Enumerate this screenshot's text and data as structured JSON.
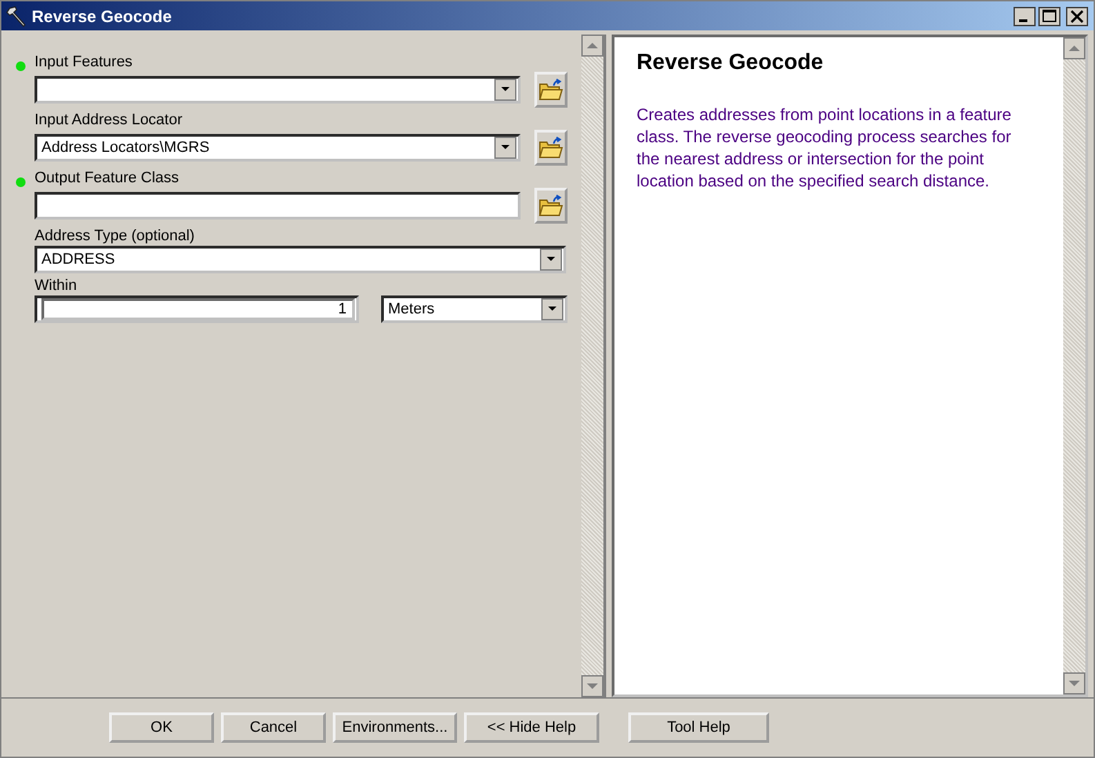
{
  "window": {
    "title": "Reverse Geocode"
  },
  "parameters": [
    {
      "kind": "combo",
      "label": "Input Features",
      "required": true
    },
    {
      "kind": "combo",
      "label": "Input Address Locator",
      "required": false,
      "value": "Address Locators\\MGRS"
    },
    {
      "kind": "text",
      "label": "Output Feature Class",
      "required": true
    },
    {
      "kind": "dropdown",
      "label": "Address Type (optional)",
      "required": false,
      "value": "ADDRESS"
    },
    {
      "kind": "distance",
      "label": "Within",
      "required": false,
      "value": "1",
      "unit": "Meters"
    }
  ],
  "help": {
    "title": "Reverse Geocode",
    "text": "Creates addresses from point locations in a feature class. The reverse geocoding process searches for the nearest address or intersection for the point location based on the specified search distance."
  },
  "buttons": [
    {
      "label": "OK",
      "kind": "main"
    },
    {
      "label": "Cancel",
      "kind": "main"
    },
    {
      "label": "Environments...",
      "kind": "main"
    },
    {
      "label": "<< Hide Help",
      "kind": "main"
    },
    {
      "label": "Tool Help",
      "kind": "apart"
    }
  ]
}
